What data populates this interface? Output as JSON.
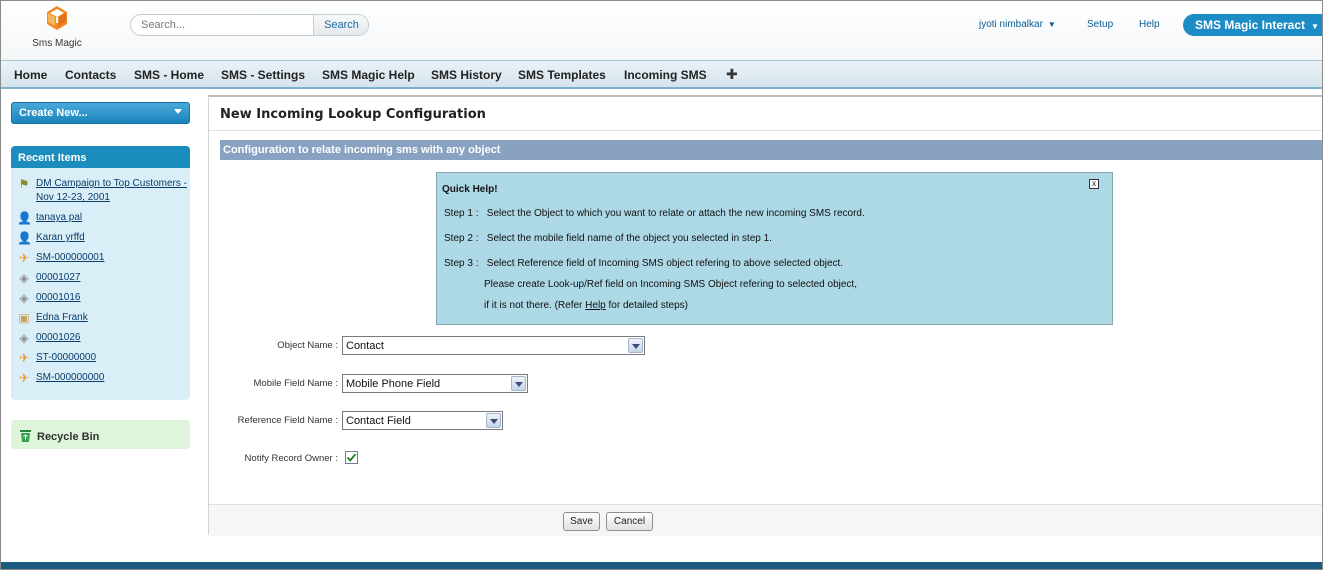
{
  "brand": {
    "name": "Sms Magic",
    "accent": "#f08a24"
  },
  "search": {
    "placeholder": "Search...",
    "button_label": "Search"
  },
  "header": {
    "user_name": "jyoti nimbalkar",
    "setup_label": "Setup",
    "help_label": "Help",
    "app_name": "SMS Magic Interact"
  },
  "tabs": [
    "Home",
    "Contacts",
    "SMS - Home",
    "SMS - Settings",
    "SMS Magic Help",
    "SMS History",
    "SMS Templates",
    "Incoming SMS"
  ],
  "sidebar": {
    "create_new_label": "Create New...",
    "recent_title": "Recent Items",
    "recent_items": [
      {
        "label": "DM Campaign to Top Customers - Nov 12-23, 2001",
        "icon": "campaign-icon"
      },
      {
        "label": "tanaya pal",
        "icon": "contact-icon"
      },
      {
        "label": "Karan yrffd",
        "icon": "contact-icon"
      },
      {
        "label": "SM-000000001",
        "icon": "sms-icon"
      },
      {
        "label": "00001027",
        "icon": "case-icon"
      },
      {
        "label": "00001016",
        "icon": "case-icon"
      },
      {
        "label": "Edna Frank",
        "icon": "contact-card-icon"
      },
      {
        "label": "00001026",
        "icon": "case-icon"
      },
      {
        "label": "ST-00000000",
        "icon": "sms-icon"
      },
      {
        "label": "SM-000000000",
        "icon": "sms-icon"
      }
    ],
    "recycle_bin_label": "Recycle Bin"
  },
  "main": {
    "title": "New Incoming Lookup Configuration",
    "section_title": "Configuration to relate incoming sms with any object",
    "quick_help": {
      "title": "Quick Help!",
      "close_label": "x",
      "step1_label": "Step 1 :",
      "step1_text": "Select the Object to which you want to relate or attach the new incoming SMS record.",
      "step2_label": "Step 2 :",
      "step2_text": "Select the mobile field name of the object you selected in step 1.",
      "step3_label": "Step 3 :",
      "step3_text": "Select Reference field of Incoming SMS object refering to above selected object.",
      "step3_line2": "Please create Look-up/Ref field on Incoming SMS Object refering to selected object,",
      "step3_line3_pre": "if it is not there. (Refer ",
      "step3_line3_link": "Help",
      "step3_line3_post": " for detailed steps)"
    },
    "form": {
      "object_name_label": "Object Name :",
      "object_name_value": "Contact",
      "mobile_field_label": "Mobile Field Name :",
      "mobile_field_value": "Mobile Phone Field",
      "reference_field_label": "Reference Field Name :",
      "reference_field_value": "Contact Field",
      "notify_owner_label": "Notify Record Owner :",
      "notify_owner_checked": true
    },
    "buttons": {
      "save": "Save",
      "cancel": "Cancel"
    }
  }
}
